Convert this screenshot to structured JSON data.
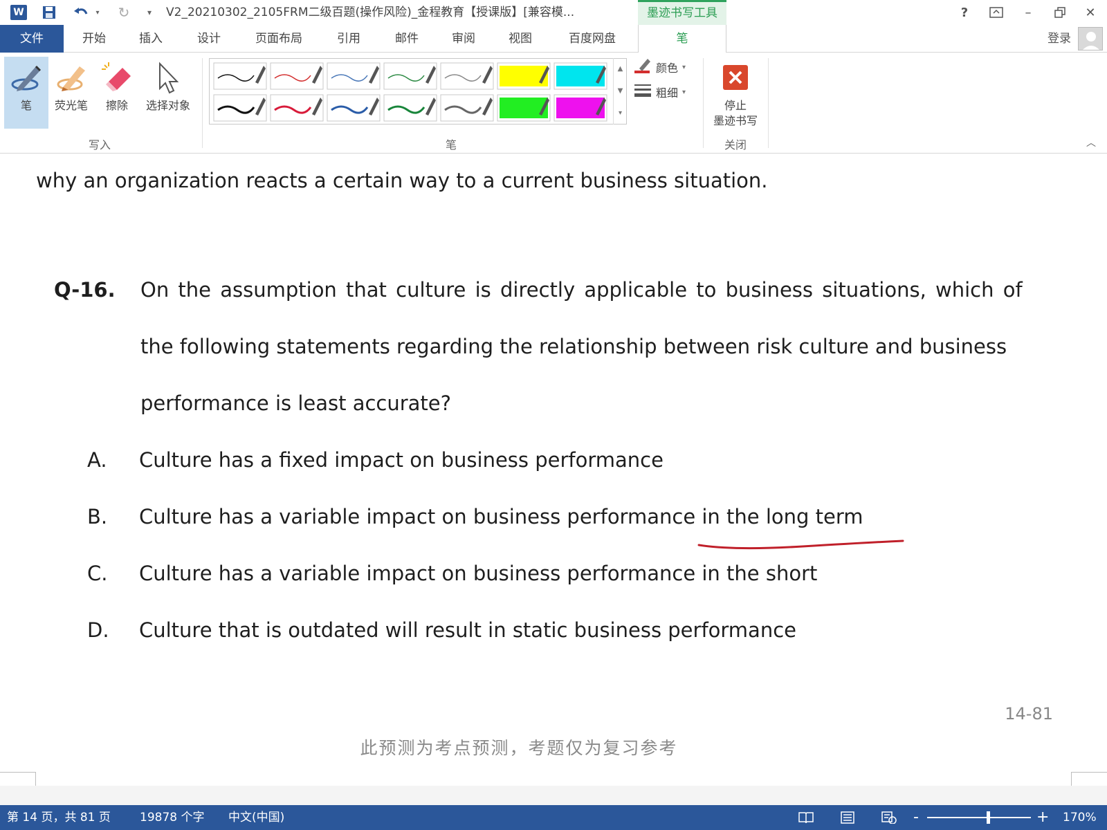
{
  "titlebar": {
    "doc_title": "V2_20210302_2105FRM二级百题(操作风险)_金程教育【授课版】[兼容模...",
    "context_tab": "墨迹书写工具",
    "help": "?",
    "min": "–",
    "close": "✕"
  },
  "tabs": [
    "文件",
    "开始",
    "插入",
    "设计",
    "页面布局",
    "引用",
    "邮件",
    "审阅",
    "视图",
    "百度网盘",
    "笔"
  ],
  "login": "登录",
  "ribbon": {
    "write_group": {
      "pen": "笔",
      "highlighter": "荧光笔",
      "eraser": "擦除",
      "select": "选择对象",
      "group_label": "写入"
    },
    "pens_group_label": "笔",
    "pen_colors": [
      "#111111",
      "#d32f2f",
      "#4a78b8",
      "#2e8b45",
      "#888888",
      "#ffff00",
      "#00e5ee",
      "#111111",
      "#d81b3a",
      "#2a5ca8",
      "#18853a",
      "#666666",
      "#22ee22",
      "#ee11ee"
    ],
    "color_btn": "颜色",
    "thickness_btn": "粗细",
    "stop_btn_line1": "停止",
    "stop_btn_line2": "墨迹书写",
    "close_group_label": "关闭"
  },
  "document": {
    "top_line": "why an organization reacts a certain way to a current business situation.",
    "question_label": "Q-16.",
    "question_lines": [
      "On the assumption that culture is directly applicable to business situations, which of",
      "the following statements regarding the relationship between risk culture and business",
      "performance is least accurate?"
    ],
    "options": [
      {
        "letter": "A.",
        "text": "Culture has a fixed impact on business performance"
      },
      {
        "letter": "B.",
        "text": "Culture has a variable impact on business performance in the long term"
      },
      {
        "letter": "C.",
        "text": "Culture has a variable impact on business performance in the short"
      },
      {
        "letter": "D.",
        "text": "Culture that is outdated will result in static business performance"
      }
    ],
    "page_label": "14-81",
    "footer_note": "此预测为考点预测，考题仅为复习参考",
    "ink_annotation_color": "#c0202a"
  },
  "statusbar": {
    "page_info": "第 14 页，共 81 页",
    "word_count": "19878 个字",
    "language": "中文(中国)",
    "zoom_minus": "-",
    "zoom_plus": "+",
    "zoom_level": "170%"
  }
}
